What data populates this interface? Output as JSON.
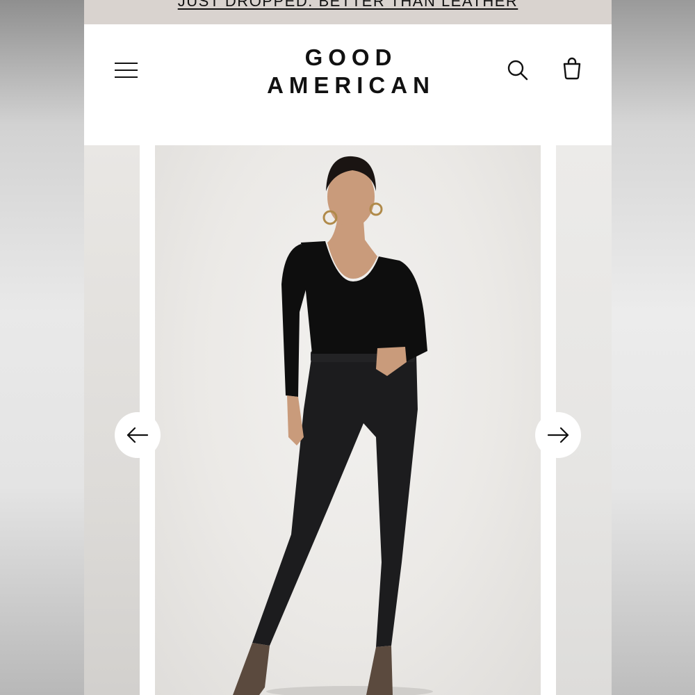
{
  "promo": {
    "text": "JUST DROPPED: BETTER THAN LEATHER"
  },
  "header": {
    "brand_line1": "GOOD",
    "brand_line2": "AMERICAN",
    "icons": {
      "menu": "hamburger-menu-icon",
      "search": "search-icon",
      "cart": "shopping-bag-icon"
    }
  },
  "carousel": {
    "prev_icon": "arrow-left-icon",
    "next_icon": "arrow-right-icon",
    "image_subject": "product-photo"
  },
  "colors": {
    "promo_bg": "#d9d3cf",
    "text": "#111111",
    "page_bg": "#ffffff"
  }
}
